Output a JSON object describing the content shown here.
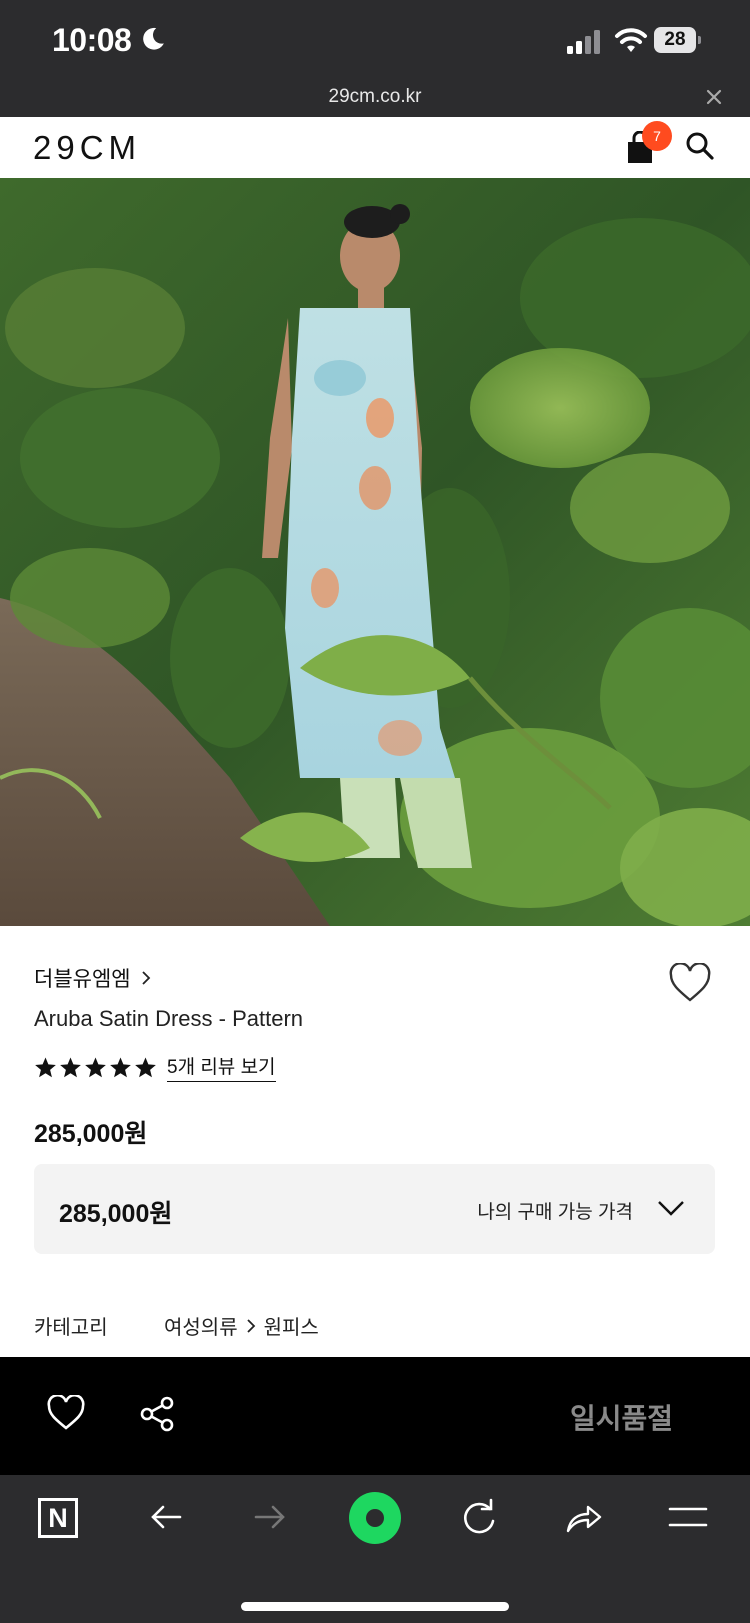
{
  "status_bar": {
    "time": "10:08",
    "battery": "28"
  },
  "browser": {
    "url": "29cm.co.kr"
  },
  "header": {
    "logo": "29CM",
    "cart_count": "7"
  },
  "product": {
    "brand": "더블유엠엠",
    "name": "Aruba Satin Dress - Pattern",
    "rating_stars": 5,
    "review_link": "5개 리뷰 보기",
    "price": "285,000원",
    "purchase_price": "285,000원",
    "purchase_price_label": "나의 구매 가능 가격"
  },
  "category": {
    "label": "카테고리",
    "path": [
      "여성의류",
      "원피스"
    ]
  },
  "action_bar": {
    "status": "일시품절"
  },
  "colors": {
    "accent_badge": "#ff4b1f",
    "dark_chrome": "#2c2c2e",
    "home_button": "#1ed760"
  }
}
